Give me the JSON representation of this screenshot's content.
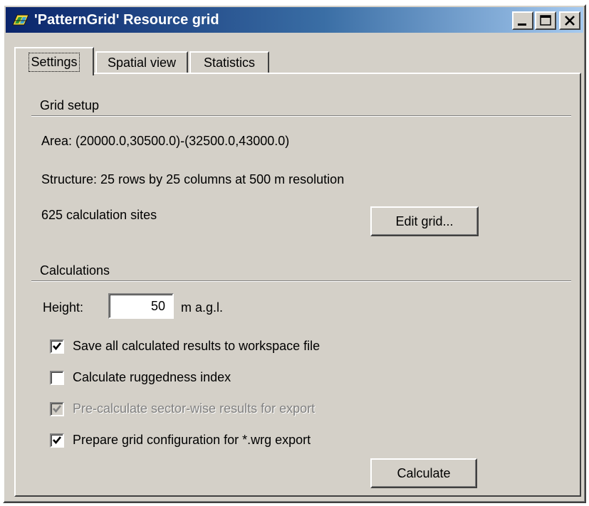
{
  "window": {
    "title": "'PatternGrid' Resource grid",
    "icon": "pattern-grid-app-icon",
    "buttons": [
      "minimize-icon",
      "maximize-icon",
      "close-icon"
    ]
  },
  "tabs": [
    {
      "label": "Settings",
      "active": true
    },
    {
      "label": "Spatial view",
      "active": false
    },
    {
      "label": "Statistics",
      "active": false
    }
  ],
  "grid_setup": {
    "title": "Grid setup",
    "area": "Area: (20000.0,30500.0)-(32500.0,43000.0)",
    "structure": "Structure: 25 rows by 25 columns at 500 m resolution",
    "sites": "625 calculation sites",
    "edit_button": "Edit grid..."
  },
  "calculations": {
    "title": "Calculations",
    "height_label": "Height:",
    "height_value": "50",
    "height_unit": "m a.g.l.",
    "options": [
      {
        "label": "Save all calculated results to workspace file",
        "checked": true,
        "enabled": true
      },
      {
        "label": "Calculate ruggedness index",
        "checked": false,
        "enabled": true
      },
      {
        "label": "Pre-calculate sector-wise results for export",
        "checked": true,
        "enabled": false
      },
      {
        "label": "Prepare grid configuration for *.wrg export",
        "checked": true,
        "enabled": true
      }
    ],
    "calculate_button": "Calculate"
  },
  "colors": {
    "face": "#d4d0c8",
    "title_start": "#0a246a",
    "title_end": "#a6caf0",
    "disabled_text": "#808080"
  }
}
